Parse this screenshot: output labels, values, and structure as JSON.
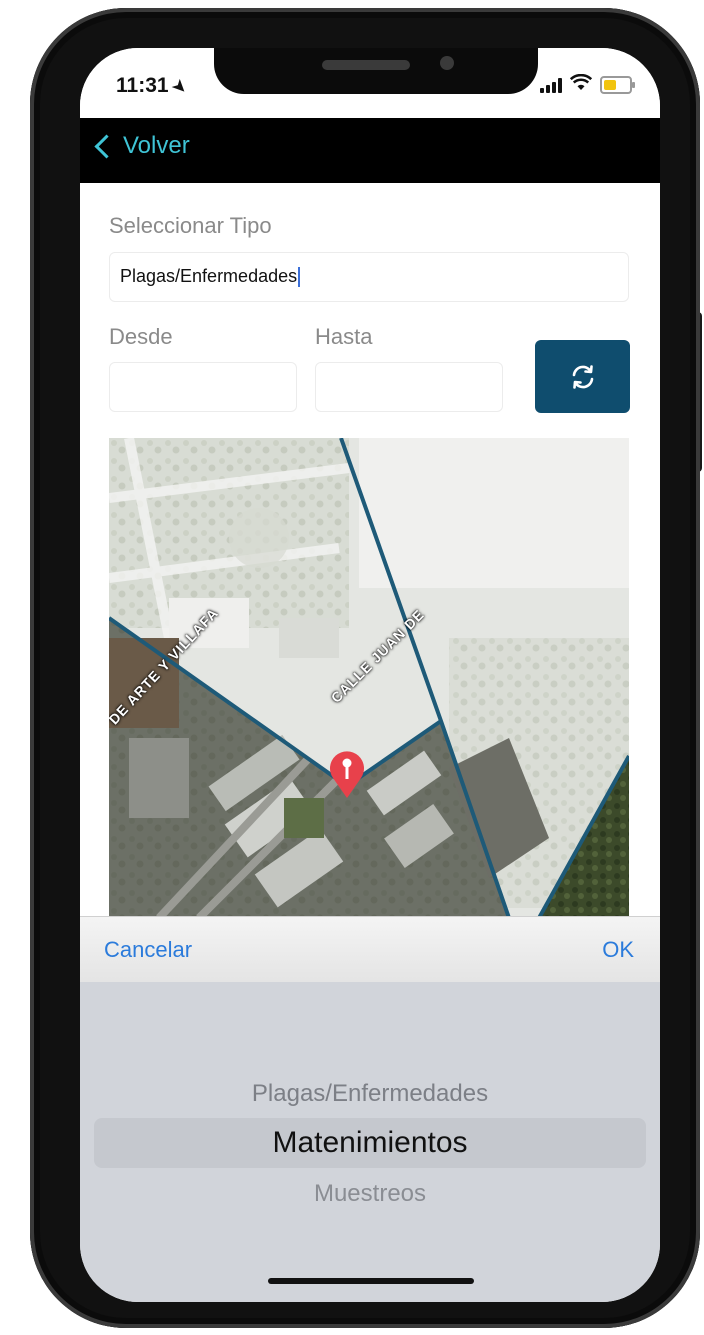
{
  "status_bar": {
    "time": "11:31"
  },
  "nav": {
    "back_label": "Volver"
  },
  "form": {
    "tipo_label": "Seleccionar Tipo",
    "tipo_value": "Plagas/Enfermedades",
    "desde_label": "Desde",
    "hasta_label": "Hasta",
    "desde_value": "",
    "hasta_value": ""
  },
  "map": {
    "street_labels": [
      "DE ARTE Y VILLAFA",
      "CALLE JUAN DE"
    ],
    "marker_color": "#e8414b",
    "boundary_color": "#1e5a78"
  },
  "picker": {
    "cancel_label": "Cancelar",
    "ok_label": "OK",
    "options": [
      "Plagas/Enfermedades",
      "Matenimientos",
      "Muestreos"
    ],
    "selected": "Matenimientos"
  },
  "colors": {
    "accent": "#3fc4d6",
    "button": "#0f4d6e",
    "picker_action": "#2b7bdb"
  }
}
